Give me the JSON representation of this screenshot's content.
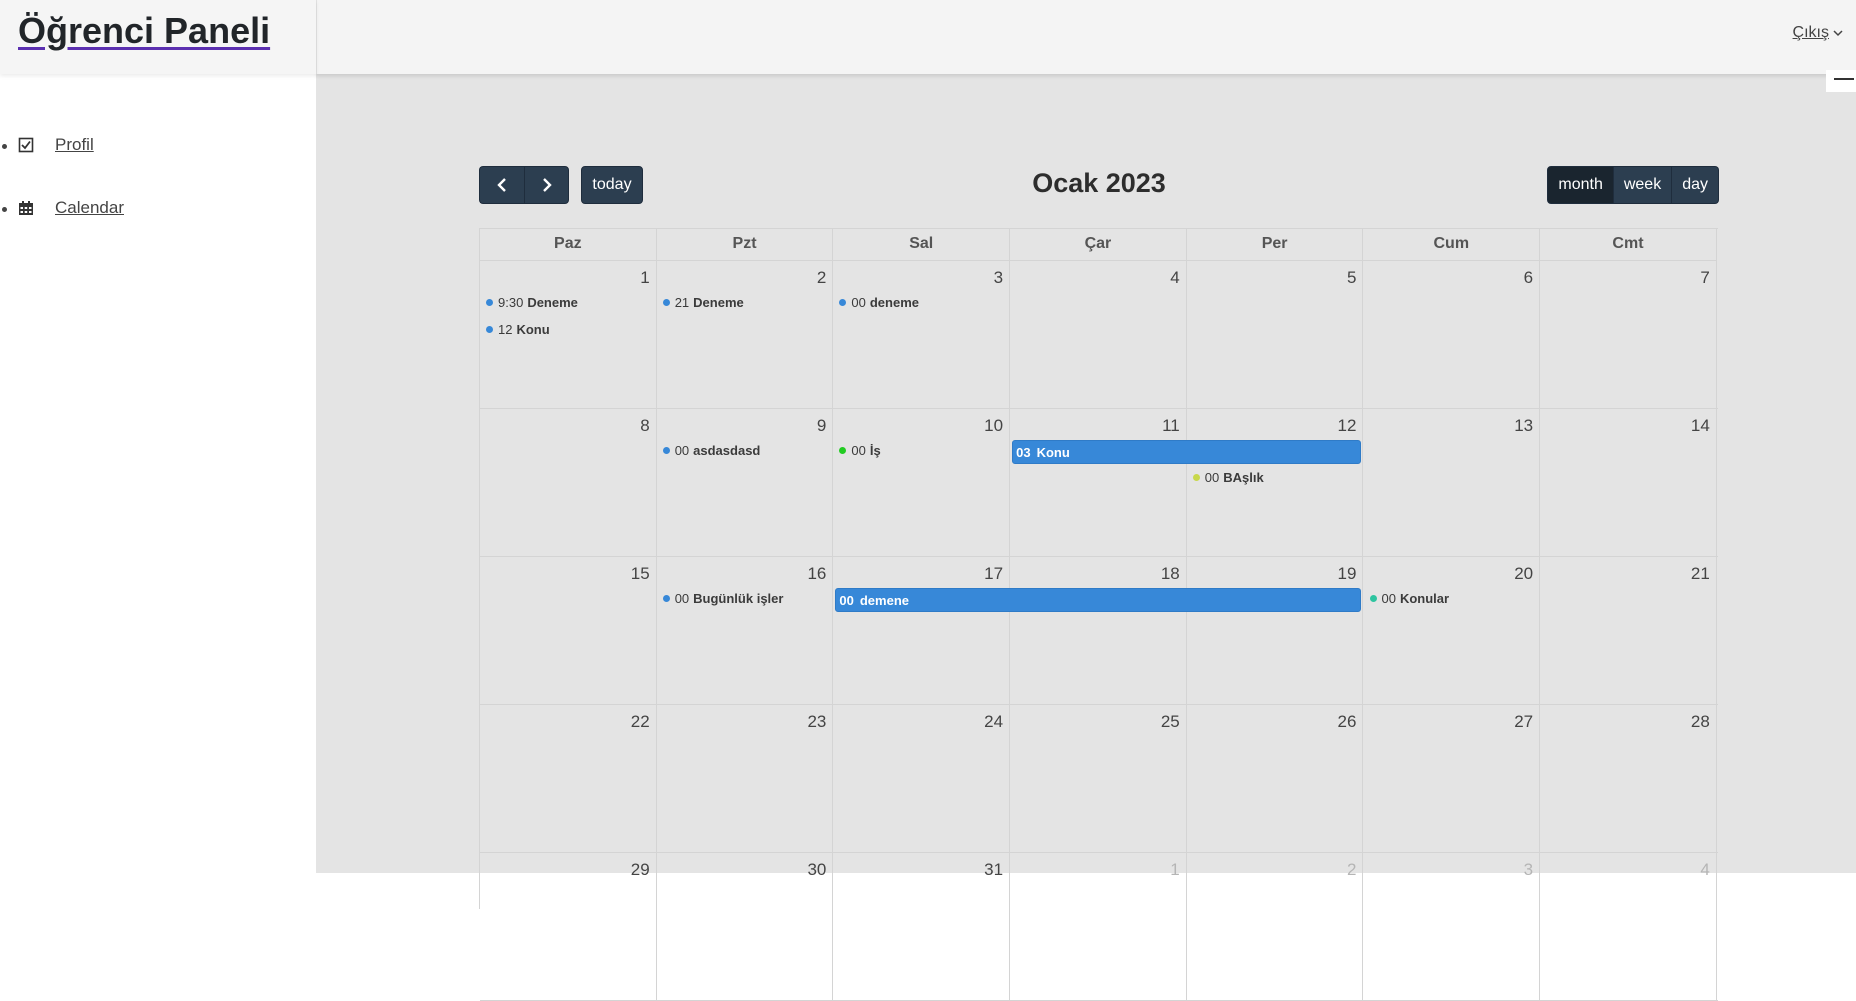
{
  "app": {
    "brand": "Öğrenci Paneli",
    "logout": "Çıkış"
  },
  "sidebar": {
    "items": [
      {
        "label": "Profil",
        "icon": "check-square-icon"
      },
      {
        "label": "Calendar",
        "icon": "calendar-icon"
      }
    ]
  },
  "toolbar": {
    "prev": "‹",
    "next": "›",
    "today": "today",
    "title": "Ocak 2023",
    "views": [
      "month",
      "week",
      "day"
    ],
    "active_view": "month"
  },
  "calendar": {
    "weekdays": [
      "Paz",
      "Pzt",
      "Sal",
      "Çar",
      "Per",
      "Cum",
      "Cmt"
    ],
    "weeks": [
      [
        "1",
        "2",
        "3",
        "4",
        "5",
        "6",
        "7"
      ],
      [
        "8",
        "9",
        "10",
        "11",
        "12",
        "13",
        "14"
      ],
      [
        "15",
        "16",
        "17",
        "18",
        "19",
        "20",
        "21"
      ],
      [
        "22",
        "23",
        "24",
        "25",
        "26",
        "27",
        "28"
      ],
      [
        "29",
        "30",
        "31",
        "1",
        "2",
        "3",
        "4"
      ]
    ],
    "dot_events": [
      {
        "week": 0,
        "day": 0,
        "row": 0,
        "time": "9:30",
        "title": "Deneme",
        "color": "#3788d8"
      },
      {
        "week": 0,
        "day": 0,
        "row": 1,
        "time": "12",
        "title": "Konu",
        "color": "#3788d8"
      },
      {
        "week": 0,
        "day": 1,
        "row": 0,
        "time": "21",
        "title": "Deneme",
        "color": "#3788d8"
      },
      {
        "week": 0,
        "day": 2,
        "row": 0,
        "time": "00",
        "title": "deneme",
        "color": "#3788d8"
      },
      {
        "week": 1,
        "day": 1,
        "row": 0,
        "time": "00",
        "title": "asdasdasd",
        "color": "#3788d8"
      },
      {
        "week": 1,
        "day": 2,
        "row": 0,
        "time": "00",
        "title": "İş",
        "color": "#22cc22"
      },
      {
        "week": 1,
        "day": 4,
        "row": 1,
        "time": "00",
        "title": "BAşlık",
        "color": "#c8d84b"
      },
      {
        "week": 2,
        "day": 1,
        "row": 0,
        "time": "00",
        "title": "Bugünlük işler",
        "color": "#3788d8"
      },
      {
        "week": 2,
        "day": 5,
        "row": 0,
        "time": "00",
        "title": "Konular",
        "color": "#2ec4a0"
      }
    ],
    "bar_events": [
      {
        "week": 1,
        "start": 3,
        "end": 4,
        "time": "03",
        "title": "Konu",
        "color": "#3788d8"
      },
      {
        "week": 2,
        "start": 2,
        "end": 4,
        "time": "00",
        "title": "demene",
        "color": "#3788d8"
      }
    ]
  }
}
